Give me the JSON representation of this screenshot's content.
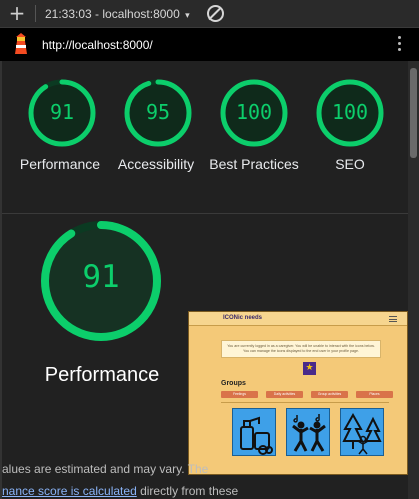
{
  "toolbar": {
    "session_text": "21:33:03 - localhost:8000",
    "caret": "▾"
  },
  "urlbar": {
    "url": "http://localhost:8000/"
  },
  "scores": [
    {
      "label": "Performance",
      "value": "91",
      "fraction": 0.91
    },
    {
      "label": "Accessibility",
      "value": "95",
      "fraction": 0.95
    },
    {
      "label": "Best Practices",
      "value": "100",
      "fraction": 1.0
    },
    {
      "label": "SEO",
      "value": "100",
      "fraction": 1.0
    }
  ],
  "performance": {
    "value": "91",
    "fraction": 0.91,
    "label": "Performance",
    "note_line1": "alues are estimated and may vary. The",
    "note_link": "nance score is calculated",
    "note_line2_rest": " directly from these"
  },
  "screenshot_preview": {
    "brand": "ICONic needs",
    "banner_line1": "You are currently logged in as a caregiver. You will be unable to interact with the icons below.",
    "banner_line2": "You can manage the icons displayed to the end user in your profile page.",
    "star": "★",
    "groups_title": "Groups",
    "group_buttons": [
      "Feelings",
      "Daily activities",
      "Group activities",
      "Places"
    ]
  },
  "colors": {
    "pass_green": "#0cce6b",
    "gauge_track": "#0b3a22",
    "link_blue": "#8ab4f8"
  },
  "icons": {
    "new_tab": "plus-icon",
    "blocked": "block-icon",
    "lighthouse": "lighthouse-icon",
    "menu": "kebab-menu-icon"
  }
}
